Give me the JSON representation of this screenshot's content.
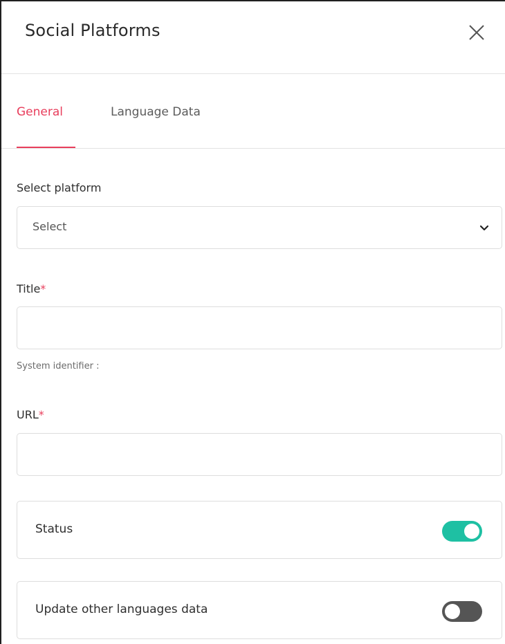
{
  "panel": {
    "title": "Social Platforms",
    "close_icon": "close-icon"
  },
  "tabs": [
    {
      "label": "General",
      "active": true
    },
    {
      "label": "Language Data",
      "active": false
    }
  ],
  "form": {
    "platform": {
      "label": "Select platform",
      "value": "Select",
      "icon": "chevron-down-icon"
    },
    "title": {
      "label": "Title",
      "required_mark": "*",
      "value": ""
    },
    "system_identifier": "System identifier :",
    "url": {
      "label": "URL",
      "required_mark": "*",
      "value": ""
    },
    "status": {
      "label": "Status",
      "on": true
    },
    "update_languages": {
      "label": "Update other languages data",
      "on": false
    }
  },
  "colors": {
    "accent": "#e83e5c",
    "toggle_on": "#1ec0a3",
    "toggle_off": "#555555"
  }
}
